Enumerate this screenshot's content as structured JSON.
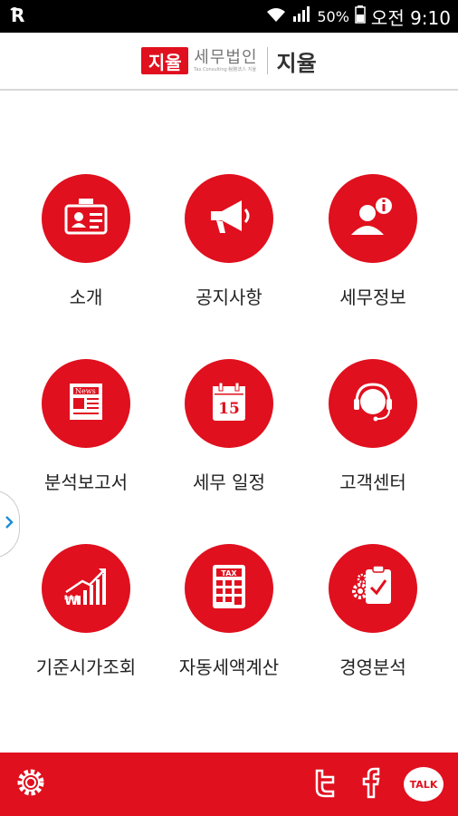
{
  "status_bar": {
    "battery": "50%",
    "time": "오전 9:10"
  },
  "header": {
    "logo_mark": "지율",
    "logo_main": "세무법인",
    "logo_sub": "Tax Consulting 稅務法人 지율",
    "title": "지율"
  },
  "menu": [
    {
      "label": "소개",
      "icon": "id-card-icon"
    },
    {
      "label": "공지사항",
      "icon": "megaphone-icon"
    },
    {
      "label": "세무정보",
      "icon": "user-info-icon"
    },
    {
      "label": "분석보고서",
      "icon": "newspaper-icon",
      "icon_text": "News"
    },
    {
      "label": "세무 일정",
      "icon": "calendar-icon",
      "icon_text": "15"
    },
    {
      "label": "고객센터",
      "icon": "headset-icon"
    },
    {
      "label": "기준시가조회",
      "icon": "chart-growth-icon",
      "icon_text": "₩"
    },
    {
      "label": "자동세액계산",
      "icon": "calculator-icon",
      "icon_text": "TAX"
    },
    {
      "label": "경영분석",
      "icon": "clipboard-gear-icon"
    }
  ],
  "bottom_bar": {
    "talk_label": "TALK"
  },
  "colors": {
    "primary": "#e0101e",
    "status_bar": "#000000"
  }
}
